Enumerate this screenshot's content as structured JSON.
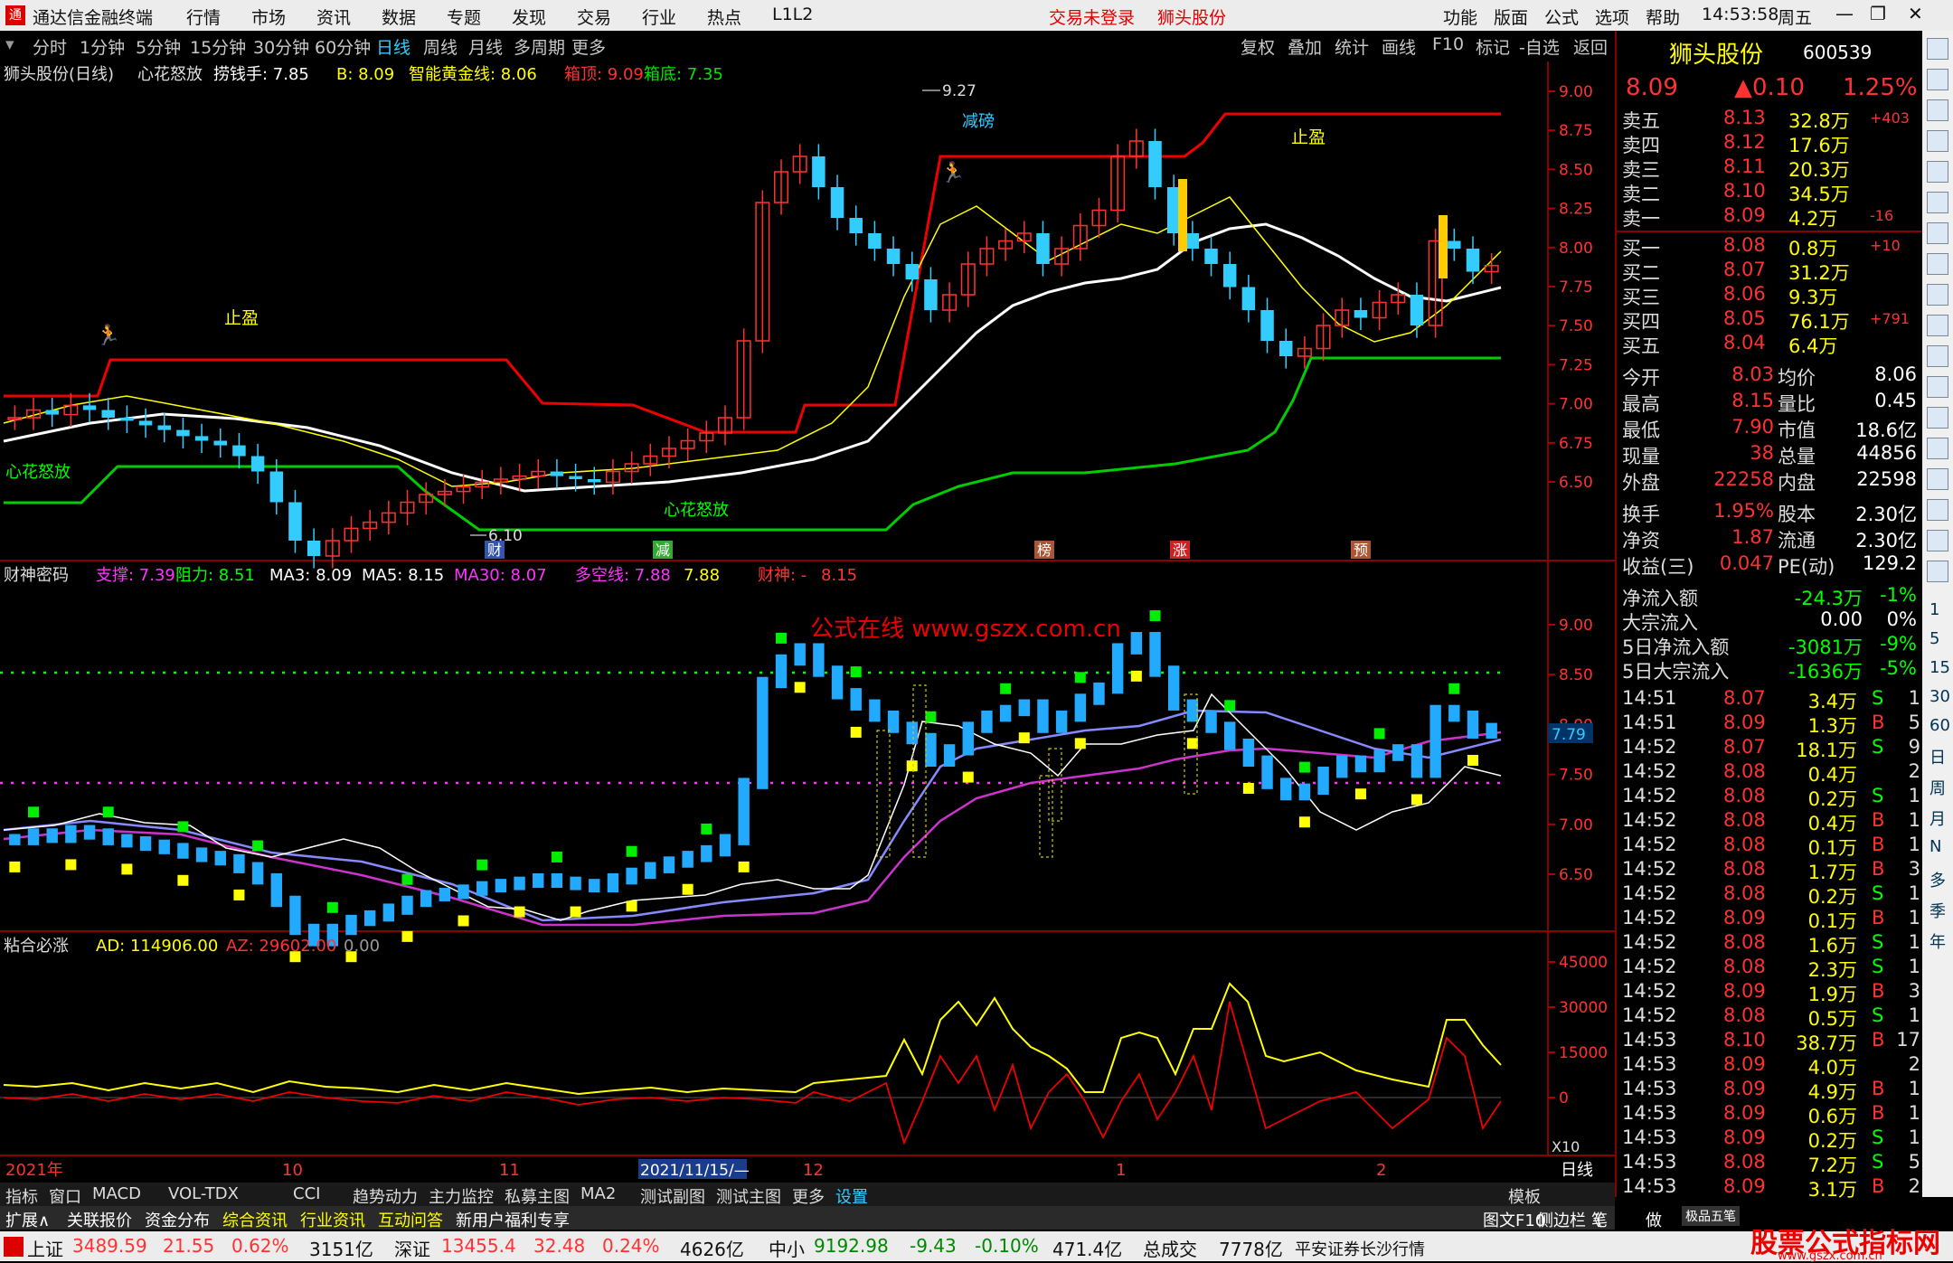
{
  "app": {
    "title": "通达信金融终端",
    "menu": [
      "行情",
      "市场",
      "资讯",
      "数据",
      "专题",
      "发现",
      "交易",
      "行业",
      "热点",
      "L1L2"
    ],
    "login_status": "交易未登录",
    "stock_link": "狮头股份",
    "right_menu": [
      "功能",
      "版面",
      "公式",
      "选项",
      "帮助"
    ],
    "time": "14:53:58",
    "weekday": "周五"
  },
  "toolbar": {
    "periods": [
      "分时",
      "1分钟",
      "5分钟",
      "15分钟",
      "30分钟",
      "60分钟",
      "日线",
      "周线",
      "月线",
      "多周期",
      "更多"
    ],
    "active_period": "日线",
    "right_buttons": [
      "复权",
      "叠加",
      "统计",
      "画线",
      "F10",
      "标记",
      "-自选",
      "返回"
    ]
  },
  "panel1": {
    "header": [
      "狮头股份(日线)",
      "心花怒放",
      "捞钱手: 7.85",
      "B: 8.09",
      "智能黄金线: 8.06",
      "箱顶: 9.09",
      "箱底: 7.35"
    ],
    "labels": {
      "stop1": "止盈",
      "stop2": "止盈",
      "bloom1": "心花怒放",
      "bloom2": "心花怒放",
      "reduce": "减磅",
      "high_mark": "9.27",
      "low_mark": "6.10"
    },
    "bottom_marks": [
      "财",
      "减",
      "榜",
      "涨",
      "预"
    ],
    "yaxis": [
      "9.00",
      "8.75",
      "8.50",
      "8.25",
      "8.00",
      "7.75",
      "7.50",
      "7.25",
      "7.00",
      "6.75",
      "6.50"
    ]
  },
  "panel2": {
    "header": [
      "财神密码",
      "支撑: 7.39",
      "阻力: 8.51",
      "MA3: 8.09",
      "MA5: 8.15",
      "MA30: 8.07",
      "多空线: 7.88",
      "7.88",
      "财神: -",
      "8.15"
    ],
    "watermark": "公式在线  www.gszx.com.cn",
    "current_price": "7.79",
    "yaxis": [
      "9.00",
      "8.50",
      "8.00",
      "7.50",
      "7.00",
      "6.50"
    ]
  },
  "panel3": {
    "header": [
      "粘合必涨",
      "AD: 114906.00",
      "AZ: 29602.00",
      "0.00"
    ],
    "yaxis": [
      "45000",
      "30000",
      "15000",
      "0"
    ],
    "scale": "X10"
  },
  "xaxis": {
    "labels": [
      "2021年",
      "10",
      "11",
      "2021/11/15/—",
      "12",
      "1",
      "2"
    ],
    "period": "日线"
  },
  "quote": {
    "name": "狮头股份",
    "code": "600539",
    "price": "8.09",
    "change": "▲0.10",
    "change_pct": "1.25%",
    "asks": [
      {
        "label": "卖五",
        "price": "8.13",
        "vol": "32.8万",
        "chg": "+403"
      },
      {
        "label": "卖四",
        "price": "8.12",
        "vol": "17.6万",
        "chg": ""
      },
      {
        "label": "卖三",
        "price": "8.11",
        "vol": "20.3万",
        "chg": ""
      },
      {
        "label": "卖二",
        "price": "8.10",
        "vol": "34.5万",
        "chg": ""
      },
      {
        "label": "卖一",
        "price": "8.09",
        "vol": "4.2万",
        "chg": "-16"
      }
    ],
    "bids": [
      {
        "label": "买一",
        "price": "8.08",
        "vol": "0.8万",
        "chg": "+10"
      },
      {
        "label": "买二",
        "price": "8.07",
        "vol": "31.2万",
        "chg": ""
      },
      {
        "label": "买三",
        "price": "8.06",
        "vol": "9.3万",
        "chg": ""
      },
      {
        "label": "买四",
        "price": "8.05",
        "vol": "76.1万",
        "chg": "+791"
      },
      {
        "label": "买五",
        "price": "8.04",
        "vol": "6.4万",
        "chg": ""
      }
    ],
    "stats": [
      [
        "今开",
        "8.03",
        "均价",
        "8.06"
      ],
      [
        "最高",
        "8.15",
        "量比",
        "0.45"
      ],
      [
        "最低",
        "7.90",
        "市值",
        "18.6亿"
      ],
      [
        "现量",
        "38",
        "总量",
        "44856"
      ],
      [
        "外盘",
        "22258",
        "内盘",
        "22598"
      ],
      [
        "换手",
        "1.95%",
        "股本",
        "2.30亿"
      ],
      [
        "净资",
        "1.87",
        "流通",
        "2.30亿"
      ],
      [
        "收益(三)",
        "0.047",
        "PE(动)",
        "129.2"
      ]
    ],
    "flows": [
      [
        "净流入额",
        "-24.3万",
        "-1%"
      ],
      [
        "大宗流入",
        "0.00",
        "0%"
      ],
      [
        "5日净流入额",
        "-3081万",
        "-9%"
      ],
      [
        "5日大宗流入",
        "-1636万",
        "-5%"
      ]
    ],
    "ticks": [
      [
        "14:51",
        "8.07",
        "3.4万",
        "S",
        "1"
      ],
      [
        "14:51",
        "8.09",
        "1.3万",
        "B",
        "5"
      ],
      [
        "14:52",
        "8.07",
        "18.1万",
        "S",
        "9"
      ],
      [
        "14:52",
        "8.08",
        "0.4万",
        "",
        "2"
      ],
      [
        "14:52",
        "8.08",
        "0.2万",
        "S",
        "1"
      ],
      [
        "14:52",
        "8.08",
        "0.4万",
        "B",
        "1"
      ],
      [
        "14:52",
        "8.08",
        "0.1万",
        "B",
        "1"
      ],
      [
        "14:52",
        "8.08",
        "1.7万",
        "B",
        "3"
      ],
      [
        "14:52",
        "8.08",
        "0.2万",
        "S",
        "1"
      ],
      [
        "14:52",
        "8.09",
        "0.1万",
        "B",
        "1"
      ],
      [
        "14:52",
        "8.08",
        "1.6万",
        "S",
        "1"
      ],
      [
        "14:52",
        "8.08",
        "2.3万",
        "S",
        "1"
      ],
      [
        "14:52",
        "8.09",
        "1.9万",
        "B",
        "3"
      ],
      [
        "14:52",
        "8.08",
        "0.5万",
        "S",
        "1"
      ],
      [
        "14:53",
        "8.10",
        "38.7万",
        "B",
        "17"
      ],
      [
        "14:53",
        "8.09",
        "4.0万",
        "",
        "2"
      ],
      [
        "14:53",
        "8.09",
        "4.9万",
        "B",
        "1"
      ],
      [
        "14:53",
        "8.09",
        "0.6万",
        "B",
        "1"
      ],
      [
        "14:53",
        "8.09",
        "0.2万",
        "S",
        "1"
      ],
      [
        "14:53",
        "8.08",
        "7.2万",
        "S",
        "5"
      ],
      [
        "14:53",
        "8.09",
        "3.1万",
        "B",
        "2"
      ]
    ]
  },
  "rightbar_text": [
    "日",
    "周",
    "月",
    "N",
    "多",
    "季",
    "年"
  ],
  "tabs1": [
    "指标",
    "窗口",
    "MACD",
    "VOL-TDX",
    "CCI",
    "趋势动力",
    "主力监控",
    "私募主图",
    "MA2",
    "测试副图",
    "测试主图",
    "更多",
    "设置",
    "模板"
  ],
  "tabs2": [
    "扩展∧",
    "关联报价",
    "资金分布",
    "综合资讯",
    "行业资讯",
    "互动问答",
    "新用户福利专享",
    "图文F10",
    "侧边栏《",
    "笔",
    "做"
  ],
  "status": {
    "sh_label": "上证",
    "sh_val": "3489.59",
    "sh_chg": "21.55",
    "sh_pct": "0.62%",
    "sh_amt": "3151亿",
    "sz_label": "深证",
    "sz_val": "13455.4",
    "sz_chg": "32.48",
    "sz_pct": "0.24%",
    "sz_amt": "4626亿",
    "zx_label": "中小",
    "zx_val": "9192.98",
    "zx_chg": "-9.43",
    "zx_pct": "-0.10%",
    "zx_amt": "471.4亿",
    "total_label": "总成交",
    "total_val": "7778亿",
    "broker": "平安证券长沙行情",
    "brand": "股票公式指标网",
    "brand_url": "www.gszx.com.cn",
    "brand_small": "极品五笔"
  },
  "colors": {
    "up": "#ff3232",
    "down": "#00e600",
    "cyan": "#3cf",
    "yellow": "#ffff00",
    "white": "#ffffff",
    "magenta": "#ff33ff"
  },
  "chart_data": [
    {
      "type": "candlestick",
      "title": "狮头股份(日线)",
      "series": [
        {
          "name": "K线",
          "values": [
            7.1,
            7.15,
            7.12,
            7.18,
            7.15,
            7.1,
            7.08,
            7.05,
            7.02,
            6.98,
            6.95,
            6.92,
            6.85,
            6.75,
            6.55,
            6.3,
            6.2,
            6.3,
            6.38,
            6.42,
            6.48,
            6.55,
            6.6,
            6.62,
            6.65,
            6.68,
            6.7,
            6.72,
            6.75,
            6.72,
            6.7,
            6.68,
            6.75,
            6.8,
            6.85,
            6.9,
            6.95,
            7.0,
            7.1,
            7.6,
            8.5,
            8.7,
            8.8,
            8.6,
            8.4,
            8.3,
            8.2,
            8.1,
            8.0,
            7.8,
            7.9,
            8.1,
            8.2,
            8.25,
            8.3,
            8.1,
            8.2,
            8.35,
            8.45,
            8.8,
            8.9,
            8.6,
            8.3,
            8.2,
            8.1,
            7.95,
            7.8,
            7.6,
            7.5,
            7.55,
            7.7,
            7.8,
            7.75,
            7.85,
            7.9,
            7.7,
            8.25,
            8.2,
            8.05,
            8.09
          ]
        },
        {
          "name": "箱顶",
          "values": [
            9.09
          ]
        },
        {
          "name": "箱底",
          "values": [
            7.35
          ]
        }
      ],
      "ylim": [
        6.3,
        9.3
      ]
    },
    {
      "type": "line",
      "title": "财神密码",
      "series": [
        {
          "name": "MA30",
          "values": [
            8.07
          ]
        },
        {
          "name": "多空线",
          "values": [
            7.88
          ]
        }
      ],
      "ylim": [
        6.3,
        9.2
      ]
    },
    {
      "type": "line",
      "title": "粘合必涨",
      "series": [
        {
          "name": "AD",
          "values": [
            114906.0
          ]
        },
        {
          "name": "AZ",
          "values": [
            29602.0
          ]
        }
      ],
      "ylim": [
        -20000,
        48000
      ]
    }
  ]
}
